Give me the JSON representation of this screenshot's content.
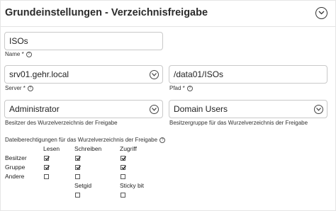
{
  "header": {
    "title": "Grundeinstellungen - Verzeichnisfreigabe",
    "toggle_icon": "chevron-down-icon"
  },
  "name": {
    "value": "ISOs",
    "label": "Name *"
  },
  "server": {
    "value": "srv01.gehr.local",
    "label": "Server *"
  },
  "path": {
    "value": "/data01/ISOs",
    "label": "Pfad *"
  },
  "owner": {
    "value": "Administrator",
    "label": "Besitzer des Wurzelverzeichnis der Freigabe"
  },
  "owner_group": {
    "value": "Domain Users",
    "label": "Besitzergruppe für das Wurzelverzeichnis der Freigabe"
  },
  "permissions": {
    "label": "Dateiberechtigungen für das Wurzelverzeichnis der Freigabe",
    "columns": [
      "Lesen",
      "Schreiben",
      "Zugriff"
    ],
    "rows": [
      {
        "label": "Besitzer",
        "checked": [
          true,
          true,
          true
        ]
      },
      {
        "label": "Gruppe",
        "checked": [
          true,
          true,
          true
        ]
      },
      {
        "label": "Andere",
        "checked": [
          false,
          false,
          false
        ]
      }
    ],
    "special": [
      {
        "label": "Setgid",
        "checked": false
      },
      {
        "label": "Sticky bit",
        "checked": false
      }
    ]
  },
  "colors": {
    "border": "#c9c9c9",
    "text": "#222222"
  }
}
